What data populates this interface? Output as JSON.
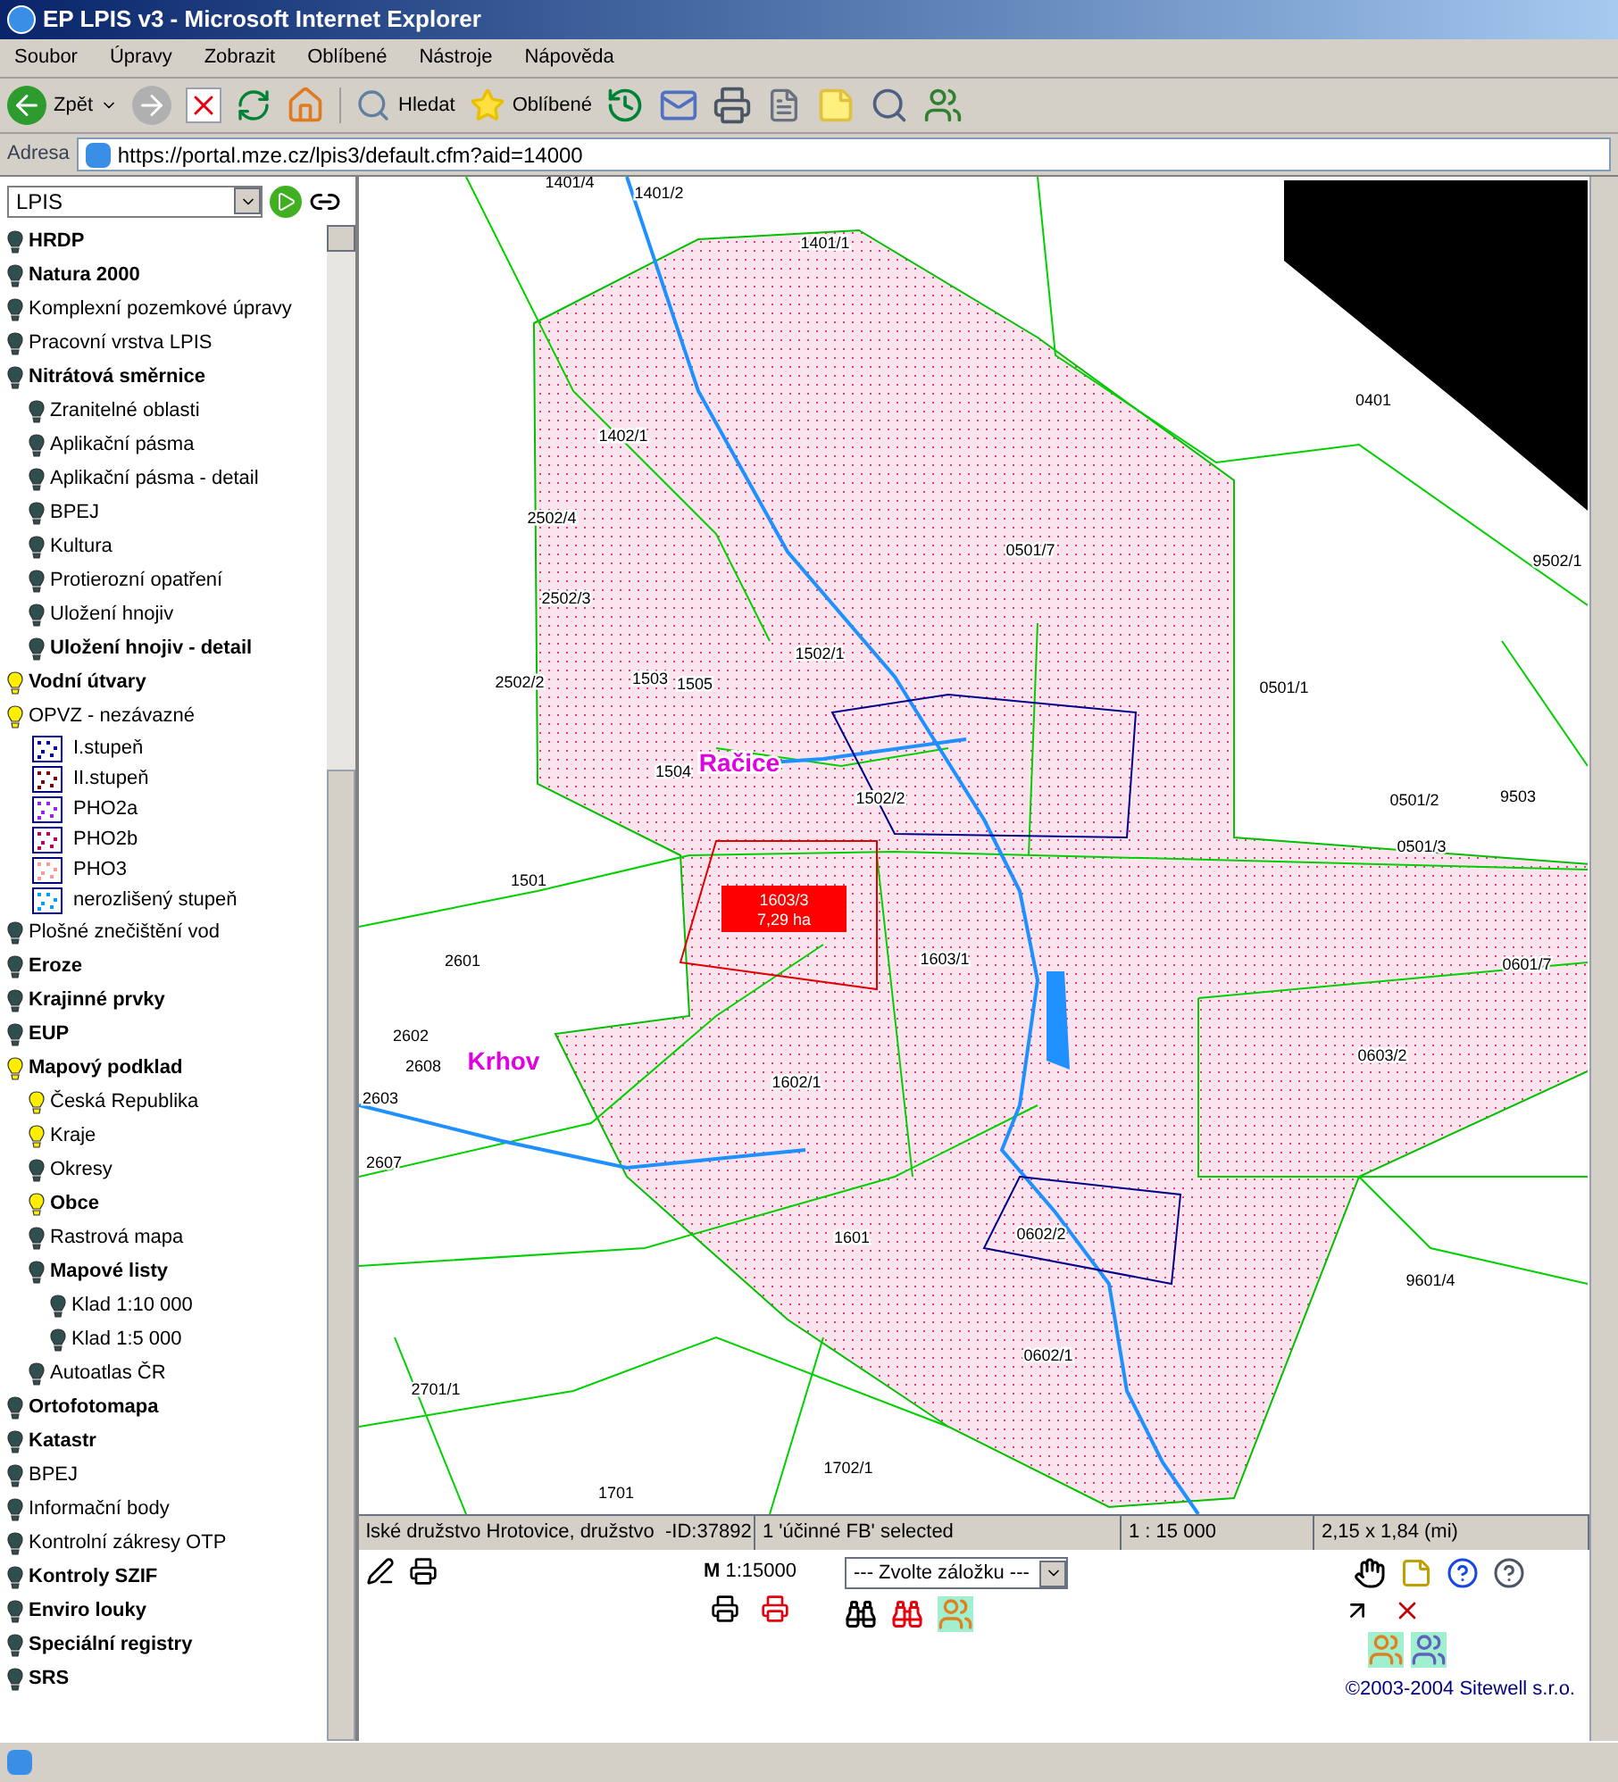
{
  "window": {
    "title": "EP LPIS v3 - Microsoft Internet Explorer"
  },
  "menu": [
    "Soubor",
    "Úpravy",
    "Zobrazit",
    "Oblíbené",
    "Nástroje",
    "Nápověda"
  ],
  "toolbar": {
    "back": "Zpět",
    "search": "Hledat",
    "favorites": "Oblíbené"
  },
  "address": {
    "label": "Adresa",
    "url": "https://portal.mze.cz/lpis3/default.cfm?aid=14000"
  },
  "layer_select": {
    "value": "LPIS"
  },
  "tree": [
    {
      "children": [
        {
          "label": "HRDP",
          "bold": true,
          "on": false
        },
        {
          "label": "Natura 2000",
          "bold": true,
          "on": false
        },
        {
          "label": "Komplexní pozemkové úpravy",
          "bold": false,
          "on": false
        },
        {
          "label": "Pracovní vrstva LPIS",
          "bold": false,
          "on": false
        },
        {
          "label": "Nitrátová směrnice",
          "bold": true,
          "on": false,
          "children": [
            {
              "label": "Zranitelné oblasti",
              "bold": false,
              "on": false
            },
            {
              "label": "Aplikační pásma",
              "bold": false,
              "on": false
            },
            {
              "label": "Aplikační pásma - detail",
              "bold": false,
              "on": false
            },
            {
              "label": "BPEJ",
              "bold": false,
              "on": false
            },
            {
              "label": "Kultura",
              "bold": false,
              "on": false
            },
            {
              "label": "Protierozní opatření",
              "bold": false,
              "on": false
            },
            {
              "label": "Uložení hnojiv",
              "bold": false,
              "on": false
            },
            {
              "label": "Uložení hnojiv - detail",
              "bold": true,
              "on": false
            }
          ]
        },
        {
          "label": "Vodní útvary",
          "bold": true,
          "on": true
        },
        {
          "label": "OPVZ - nezávazné",
          "bold": false,
          "on": true
        },
        {
          "kind": "legend",
          "label": "I.stupeň",
          "color": "#0000a0"
        },
        {
          "kind": "legend",
          "label": "II.stupeň",
          "color": "#800000"
        },
        {
          "kind": "legend",
          "label": "PHO2a",
          "color": "#a020f0"
        },
        {
          "kind": "legend",
          "label": "PHO2b",
          "color": "#c00060"
        },
        {
          "kind": "legend",
          "label": "PHO3",
          "color": "#ff9999"
        },
        {
          "kind": "legend",
          "label": "nerozlišený stupeň",
          "color": "#00a0ff"
        },
        {
          "label": "Plošné znečištění vod",
          "bold": false,
          "on": false
        },
        {
          "label": "Eroze",
          "bold": true,
          "on": false
        }
      ]
    },
    {
      "label": "Krajinné prvky",
      "bold": true,
      "on": false
    },
    {
      "label": "EUP",
      "bold": true,
      "on": false
    },
    {
      "label": "Mapový podklad",
      "bold": true,
      "on": true,
      "children": [
        {
          "label": "Česká Republika",
          "bold": false,
          "on": true
        },
        {
          "label": "Kraje",
          "bold": false,
          "on": true
        },
        {
          "label": "Okresy",
          "bold": false,
          "on": false
        },
        {
          "label": "Obce",
          "bold": true,
          "on": true
        },
        {
          "label": "Rastrová mapa",
          "bold": false,
          "on": false
        },
        {
          "label": "Mapové listy",
          "bold": true,
          "on": false,
          "children": [
            {
              "label": "Klad 1:10 000",
              "bold": false,
              "on": false
            },
            {
              "label": "Klad 1:5 000",
              "bold": false,
              "on": false
            }
          ]
        },
        {
          "label": "Autoatlas ČR",
          "bold": false,
          "on": false
        }
      ]
    },
    {
      "label": "Ortofotomapa",
      "bold": true,
      "on": false
    },
    {
      "label": "Katastr",
      "bold": true,
      "on": false
    },
    {
      "label": "BPEJ",
      "bold": false,
      "on": false
    },
    {
      "label": "Informační body",
      "bold": false,
      "on": false
    },
    {
      "label": "Kontrolní zákresy OTP",
      "bold": false,
      "on": false
    },
    {
      "label": "Kontroly SZIF",
      "bold": true,
      "on": false
    },
    {
      "label": "Enviro louky",
      "bold": true,
      "on": false
    },
    {
      "label": "Speciální registry",
      "bold": true,
      "on": false
    },
    {
      "label": "SRS",
      "bold": true,
      "on": false
    }
  ],
  "map": {
    "labels": [
      {
        "kind": "parcel",
        "text": "1401/4"
      },
      {
        "kind": "parcel",
        "text": "1401/2"
      },
      {
        "kind": "parcel",
        "text": "1401/1"
      },
      {
        "kind": "parcel",
        "text": "0401"
      },
      {
        "kind": "parcel",
        "text": "1402/1"
      },
      {
        "kind": "parcel",
        "text": "2502/4"
      },
      {
        "kind": "parcel",
        "text": "0501/7"
      },
      {
        "kind": "parcel",
        "text": "9502/1"
      },
      {
        "kind": "parcel",
        "text": "2502/3"
      },
      {
        "kind": "parcel",
        "text": "1502/1"
      },
      {
        "kind": "parcel",
        "text": "2502/2"
      },
      {
        "kind": "parcel",
        "text": "1503"
      },
      {
        "kind": "parcel",
        "text": "1505"
      },
      {
        "kind": "parcel",
        "text": "0501/1"
      },
      {
        "kind": "parcel",
        "text": "1504"
      },
      {
        "kind": "town",
        "text": "Račice"
      },
      {
        "kind": "parcel",
        "text": "1502/2"
      },
      {
        "kind": "parcel",
        "text": "0501/2"
      },
      {
        "kind": "parcel",
        "text": "9503"
      },
      {
        "kind": "parcel",
        "text": "0501/3"
      },
      {
        "kind": "parcel",
        "text": "1501"
      },
      {
        "kind": "parcel",
        "text": "2601"
      },
      {
        "kind": "parcel",
        "text": "1603/1"
      },
      {
        "kind": "parcel",
        "text": "0601/7"
      },
      {
        "kind": "town",
        "text": "Krhov"
      },
      {
        "kind": "parcel",
        "text": "2602"
      },
      {
        "kind": "parcel",
        "text": "2608"
      },
      {
        "kind": "parcel",
        "text": "0603/2"
      },
      {
        "kind": "parcel",
        "text": "2603"
      },
      {
        "kind": "parcel",
        "text": "1602/1"
      },
      {
        "kind": "parcel",
        "text": "2607"
      },
      {
        "kind": "parcel",
        "text": "1601"
      },
      {
        "kind": "parcel",
        "text": "0602/2"
      },
      {
        "kind": "parcel",
        "text": "9601/4"
      },
      {
        "kind": "parcel",
        "text": "0602/1"
      },
      {
        "kind": "parcel",
        "text": "2701/1"
      },
      {
        "kind": "parcel",
        "text": "1701"
      },
      {
        "kind": "parcel",
        "text": "1702/1"
      }
    ],
    "selected_parcel": {
      "code": "1603/3",
      "area": "7,29 ha"
    }
  },
  "map_status": [
    "lské družstvo Hrotovice, družstvo  -ID:37892",
    "1 'účinné FB' selected",
    "1 : 15 000",
    "2,15 x 1,84 (mi)"
  ],
  "bottom": {
    "scale": "**M** 1:15000",
    "bookmark_select": "--- Zvolte záložku ---",
    "copyright": "©2003-2004 Sitewell s.r.o."
  }
}
